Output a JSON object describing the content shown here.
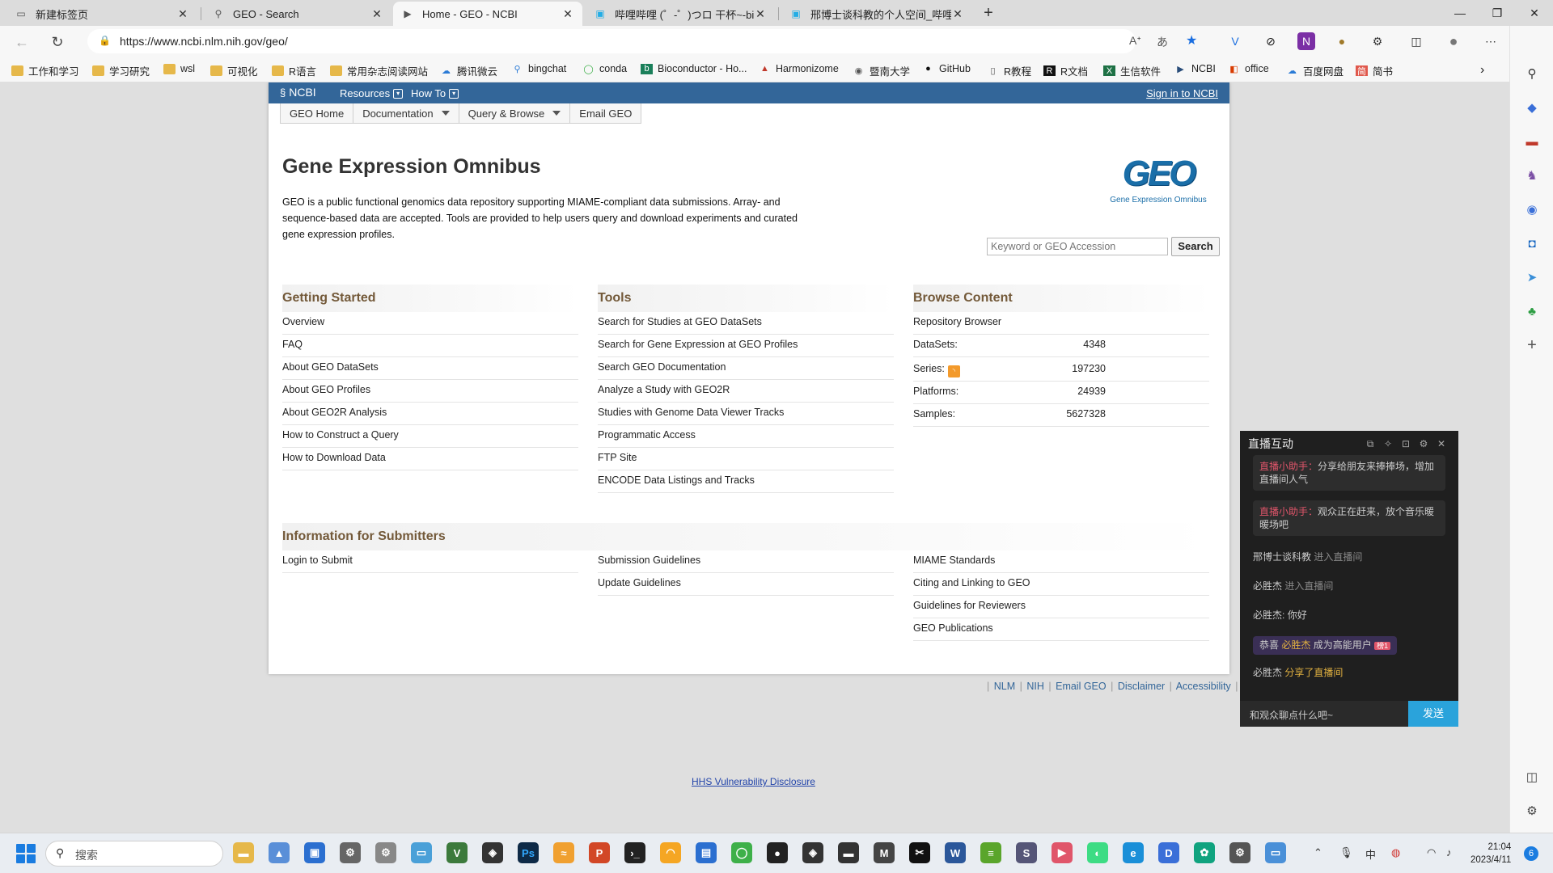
{
  "browser": {
    "tabs": [
      {
        "label": "新建标签页",
        "icon": "new-tab-icon"
      },
      {
        "label": "GEO - Search",
        "icon": "search-icon"
      },
      {
        "label": "Home - GEO - NCBI",
        "icon": "ncbi-icon"
      },
      {
        "label": "哔哩哔哩 (゜-゜)つロ 干杯~-bili",
        "icon": "bilibili-icon"
      },
      {
        "label": "邢博士谈科教的个人空间_哔哩哔",
        "icon": "bilibili-icon"
      }
    ],
    "url": "https://www.ncbi.nlm.nih.gov/geo/",
    "bookmarks": [
      {
        "label": "工作和学习",
        "icon": "folder-icon"
      },
      {
        "label": "学习研究",
        "icon": "folder-icon"
      },
      {
        "label": "wsl",
        "icon": "folder-icon"
      },
      {
        "label": "可视化",
        "icon": "folder-icon"
      },
      {
        "label": "R语言",
        "icon": "folder-icon"
      },
      {
        "label": "常用杂志阅读网站",
        "icon": "folder-icon"
      },
      {
        "label": "腾讯微云",
        "icon": "cloud-icon"
      },
      {
        "label": "bingchat",
        "icon": "search-icon"
      },
      {
        "label": "conda",
        "icon": "conda-icon"
      },
      {
        "label": "Bioconductor - Ho...",
        "icon": "bioconductor-icon"
      },
      {
        "label": "Harmonizome",
        "icon": "harmonizome-icon"
      },
      {
        "label": "暨南大学",
        "icon": "university-icon"
      },
      {
        "label": "GitHub",
        "icon": "github-icon"
      },
      {
        "label": "R教程",
        "icon": "document-icon"
      },
      {
        "label": "R文档",
        "icon": "r-icon"
      },
      {
        "label": "生信软件",
        "icon": "excel-icon"
      },
      {
        "label": "NCBI",
        "icon": "ncbi-icon"
      },
      {
        "label": "office",
        "icon": "office-icon"
      },
      {
        "label": "百度网盘",
        "icon": "baidu-pan-icon"
      },
      {
        "label": "简书",
        "icon": "jianshu-icon"
      }
    ]
  },
  "ncbi": {
    "logo": "NCBI",
    "menus": [
      "Resources",
      "How To"
    ],
    "signin": "Sign in to NCBI"
  },
  "geo_nav": [
    {
      "label": "GEO Home",
      "dropdown": false
    },
    {
      "label": "Documentation",
      "dropdown": true
    },
    {
      "label": "Query & Browse",
      "dropdown": true
    },
    {
      "label": "Email GEO",
      "dropdown": false
    }
  ],
  "page": {
    "title": "Gene Expression Omnibus",
    "description": "GEO is a public functional genomics data repository supporting MIAME-compliant data submissions. Array- and sequence-based data are accepted. Tools are provided to help users query and download experiments and curated gene expression profiles.",
    "logo_word": "GEO",
    "logo_sub": "Gene Expression Omnibus",
    "search_placeholder": "Keyword or GEO Accession",
    "search_button": "Search"
  },
  "sections": {
    "getting_started": {
      "title": "Getting Started",
      "items": [
        "Overview",
        "FAQ",
        "About GEO DataSets",
        "About GEO Profiles",
        "About GEO2R Analysis",
        "How to Construct a Query",
        "How to Download Data"
      ]
    },
    "tools": {
      "title": "Tools",
      "items": [
        "Search for Studies at GEO DataSets",
        "Search for Gene Expression at GEO Profiles",
        "Search GEO Documentation",
        "Analyze a Study with GEO2R",
        "Studies with Genome Data Viewer Tracks",
        "Programmatic Access",
        "FTP Site",
        "ENCODE Data Listings and Tracks"
      ]
    },
    "browse": {
      "title": "Browse Content",
      "items": [
        {
          "label": "Repository Browser",
          "value": ""
        },
        {
          "label": "DataSets:",
          "value": "4348"
        },
        {
          "label": "Series:",
          "value": "197230",
          "rss": true
        },
        {
          "label": "Platforms:",
          "value": "24939"
        },
        {
          "label": "Samples:",
          "value": "5627328"
        }
      ]
    },
    "submitters": {
      "title": "Information for Submitters",
      "col1": [
        "Login to Submit"
      ],
      "col2": [
        "Submission Guidelines",
        "Update Guidelines"
      ],
      "col3": [
        "MIAME Standards",
        "Citing and Linking to GEO",
        "Guidelines for Reviewers",
        "GEO Publications"
      ]
    }
  },
  "footer": {
    "links": [
      "NLM",
      "NIH",
      "Email GEO",
      "Disclaimer",
      "Accessibility"
    ],
    "hhs": "HHS Vulnerability Disclosure"
  },
  "chat": {
    "title": "直播互动",
    "messages": [
      {
        "type": "card",
        "prefix": "直播小助手：",
        "text": "分享给朋友来捧捧场，增加直播间人气"
      },
      {
        "type": "card",
        "prefix": "直播小助手：",
        "text": "观众正在赶来，放个音乐暖暖场吧"
      },
      {
        "type": "line",
        "user": "邢博士谈科教",
        "text": "进入直播间"
      },
      {
        "type": "line",
        "user": "必胜杰",
        "text": "进入直播间"
      },
      {
        "type": "line",
        "user": "必胜杰:",
        "text": "你好"
      },
      {
        "type": "badge",
        "prefix": "恭喜",
        "user": "必胜杰",
        "text": "成为高能用户",
        "badge": "榜1"
      },
      {
        "type": "line",
        "user": "必胜杰",
        "text": "分享了直播间"
      }
    ],
    "input_placeholder": "和观众聊点什么吧~",
    "send": "发送"
  },
  "taskbar": {
    "search_label": "搜索",
    "time": "21:04",
    "date": "2023/4/11",
    "notifications": "6"
  },
  "colors": {
    "ncbi_blue": "#336699",
    "section_heading": "#735939",
    "geo_logo": "#1a6ea8",
    "chat_send": "#2aa3db"
  }
}
